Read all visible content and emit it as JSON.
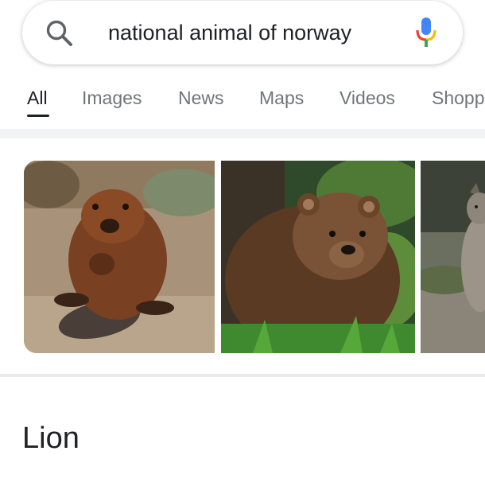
{
  "search": {
    "query": "national animal of norway",
    "icons": {
      "search": "search-icon",
      "voice": "microphone-icon"
    }
  },
  "tabs": [
    {
      "label": "All",
      "active": true
    },
    {
      "label": "Images",
      "active": false
    },
    {
      "label": "News",
      "active": false
    },
    {
      "label": "Maps",
      "active": false
    },
    {
      "label": "Videos",
      "active": false
    },
    {
      "label": "Shopp",
      "active": false
    }
  ],
  "images": [
    {
      "subject": "beaver"
    },
    {
      "subject": "brown bear"
    },
    {
      "subject": "wolf"
    }
  ],
  "answer": {
    "title": "Lion"
  },
  "colors": {
    "google_blue": "#4285f4",
    "google_red": "#ea4335",
    "google_yellow": "#fbbc05",
    "google_green": "#34a853",
    "text_primary": "#202124",
    "text_secondary": "#70757a"
  }
}
